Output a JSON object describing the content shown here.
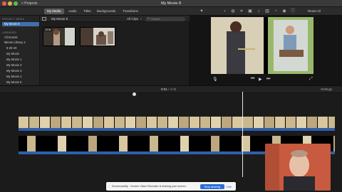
{
  "window": {
    "title": "My Movie 8",
    "back_label": "< Projects"
  },
  "toolbar": {
    "tabs": [
      "My Media",
      "Audio",
      "Titles",
      "Backgrounds",
      "Transitions"
    ],
    "reset_all": "Reset All"
  },
  "sidebar": {
    "project_media_header": "PROJECT MEDIA",
    "project_item": "My Movie 8",
    "libraries_header": "LIBRARIES",
    "items": [
      "All Events",
      "iMovie Library 2",
      "8-20-20",
      "My Movie",
      "My Movie 1",
      "My Movie 2",
      "My Movie 3",
      "My Movie 4",
      "My Movie 5",
      "My Movie 6"
    ]
  },
  "browser": {
    "title": "My Movie 8",
    "filter": "All Clips",
    "search_placeholder": "Search",
    "thumb_duration": "18.5s"
  },
  "timeline": {
    "timecode": "0:01",
    "duration": "/ 3:09",
    "settings_label": "Settings"
  },
  "share_banner": {
    "text": "Screencastify - Screen Video Recorder is sharing your screen.",
    "stop_label": "Stop sharing",
    "hide_label": "Hide"
  },
  "colors": {
    "accent": "#3f6fae",
    "audio_track": "#2f5fa8",
    "share_button": "#2a6fdb"
  }
}
